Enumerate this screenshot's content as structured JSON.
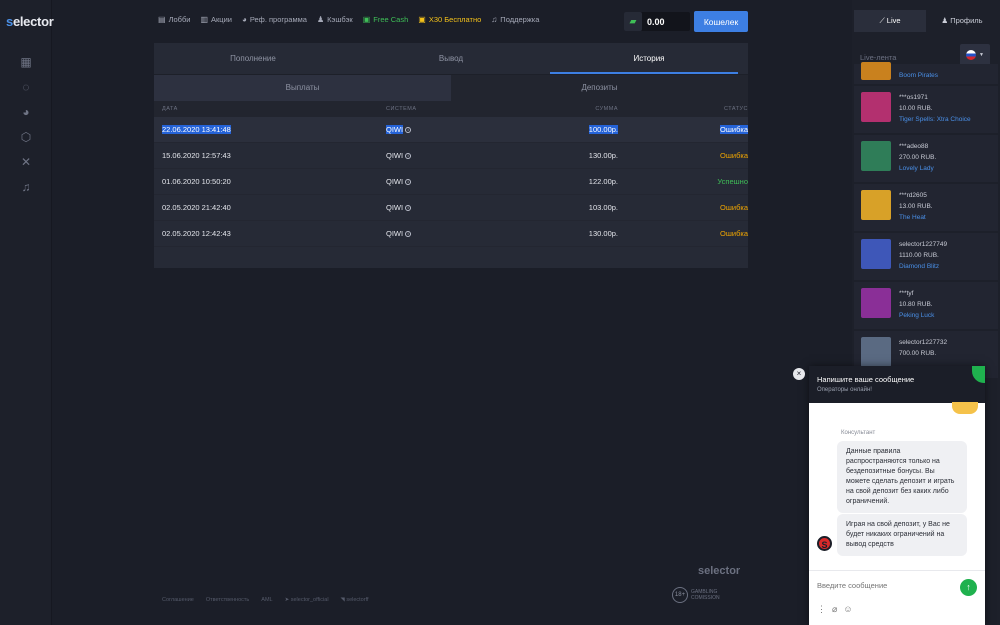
{
  "brand": {
    "logo_s": "s",
    "logo_rest": "elector"
  },
  "rail_icons": [
    "slots-icon",
    "live-casino-icon",
    "sports-icon",
    "dice-icon",
    "crossed-swords-icon",
    "support-headset-icon"
  ],
  "topnav": {
    "lobby": "Лобби",
    "promo": "Акции",
    "referral": "Реф. программа",
    "cashback": "Кэшбэк",
    "freecash": "Free Cash",
    "x30": "X30 Бесплатно",
    "support": "Поддержка"
  },
  "balance": {
    "value": "0.00",
    "wallet_label": "Кошелек"
  },
  "tabs": {
    "deposit": "Пополнение",
    "withdraw": "Вывод",
    "history": "История"
  },
  "subtabs": {
    "payouts": "Выплаты",
    "deposits": "Депозиты"
  },
  "table": {
    "headers": {
      "date": "ДАТА",
      "system": "СИСТЕМА",
      "amount": "СУММА",
      "status": "СТАТУС"
    },
    "rows": [
      {
        "date": "22.06.2020 13:41:48",
        "system": "QIWI",
        "amount": "100.00р.",
        "status": "Ошибка"
      },
      {
        "date": "15.06.2020 12:57:43",
        "system": "QIWI",
        "amount": "130.00р.",
        "status": "Ошибка"
      },
      {
        "date": "01.06.2020 10:50:20",
        "system": "QIWI",
        "amount": "122.00р.",
        "status": "Успешно"
      },
      {
        "date": "02.05.2020 21:42:40",
        "system": "QIWI",
        "amount": "103.00р.",
        "status": "Ошибка"
      },
      {
        "date": "02.05.2020 12:42:43",
        "system": "QIWI",
        "amount": "130.00р.",
        "status": "Ошибка"
      }
    ]
  },
  "footer": {
    "agreement": "Соглашение",
    "responsibility": "Ответственность",
    "aml": "AML",
    "telegram": "selector_official",
    "vk": "selectorff",
    "logo": "selector",
    "gambling_age": "18+",
    "gambling_line1": "GAMBLING",
    "gambling_line2": "COMISSION"
  },
  "right": {
    "live_tab": "Live",
    "profile_tab": "Профиль",
    "live_feed_label": "Live-лента",
    "feed": [
      {
        "user": "",
        "amount": "",
        "game": "Boom Pirates",
        "color": "#c9811e"
      },
      {
        "user": "***os1971",
        "amount": "10.00 RUB.",
        "game": "Tiger Spells: Xtra Choice",
        "color": "#b3306f"
      },
      {
        "user": "***adeo88",
        "amount": "270.00 RUB.",
        "game": "Lovely Lady",
        "color": "#2f7d58"
      },
      {
        "user": "***rd2605",
        "amount": "13.00 RUB.",
        "game": "The Heat",
        "color": "#d8a128"
      },
      {
        "user": "selector1227749",
        "amount": "1110.00 RUB.",
        "game": "Diamond Blitz",
        "color": "#3e57b8"
      },
      {
        "user": "***tyf",
        "amount": "10.80 RUB.",
        "game": "Peking Luck",
        "color": "#8a2f97"
      },
      {
        "user": "selector1227732",
        "amount": "700.00 RUB.",
        "game": "",
        "color": "#5a6a82"
      }
    ]
  },
  "chat": {
    "title": "Напишите ваше сообщение",
    "subtitle": "Операторы онлайн!",
    "consultant": "Консультант",
    "msg1": "Данные правила распространяются только на бездепозитные бонусы. Вы можете сделать депозит и играть на свой депозит без каких либо ограничений.",
    "msg2": "Играя на свой депозит, у Вас не будет никаких ограничений на вывод средств",
    "avatar_letter": "S",
    "placeholder": "Введите сообщение"
  }
}
